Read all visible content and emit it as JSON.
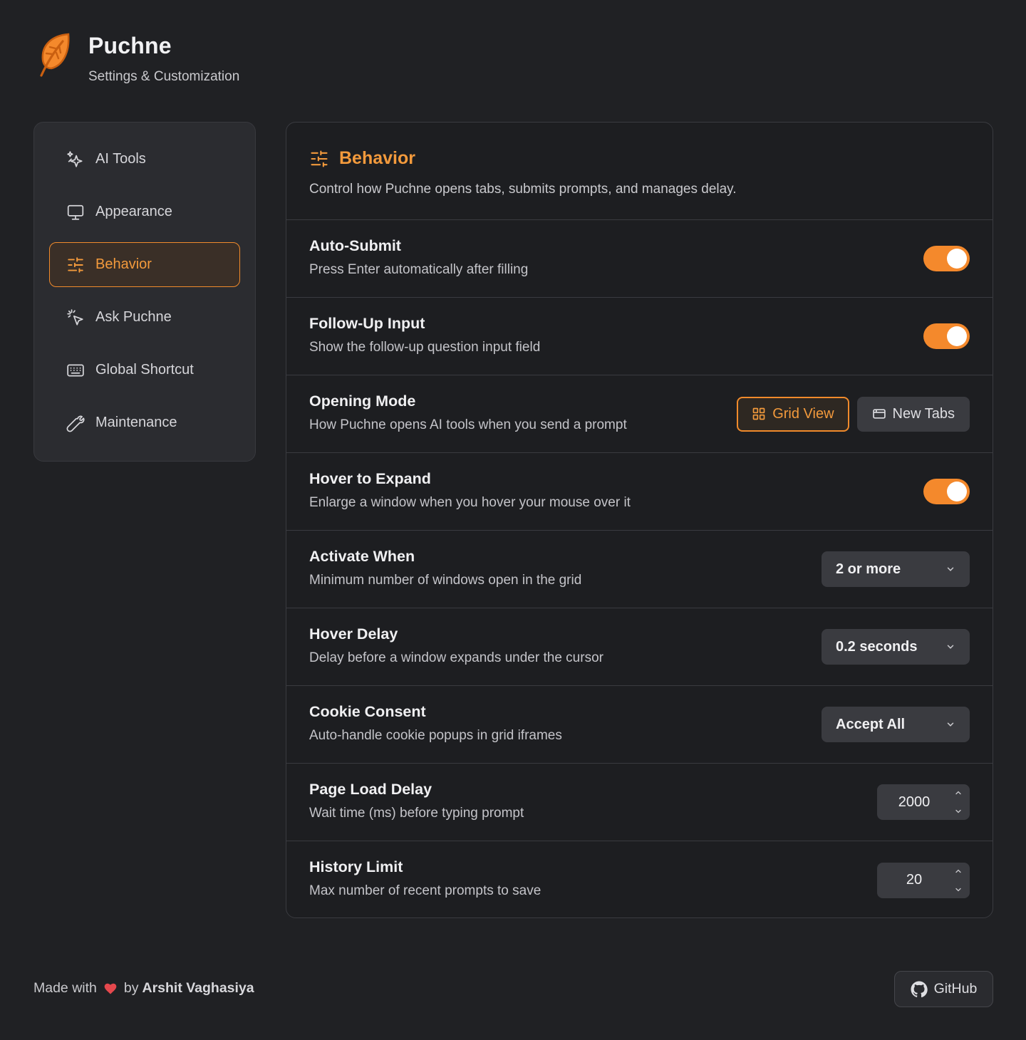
{
  "app": {
    "title": "Puchne",
    "subtitle": "Settings & Customization",
    "logo_icon": "leaf-icon"
  },
  "accent_color": "#f4892c",
  "sidebar": {
    "items": [
      {
        "label": "AI Tools",
        "icon": "sparkles-icon",
        "active": false
      },
      {
        "label": "Appearance",
        "icon": "monitor-icon",
        "active": false
      },
      {
        "label": "Behavior",
        "icon": "sliders-icon",
        "active": true
      },
      {
        "label": "Ask Puchne",
        "icon": "cursor-click-icon",
        "active": false
      },
      {
        "label": "Global Shortcut",
        "icon": "keyboard-icon",
        "active": false
      },
      {
        "label": "Maintenance",
        "icon": "wrench-icon",
        "active": false
      }
    ]
  },
  "panel": {
    "title": "Behavior",
    "description": "Control how Puchne opens tabs, submits prompts, and manages delay.",
    "settings": {
      "auto_submit": {
        "title": "Auto-Submit",
        "desc": "Press Enter automatically after filling",
        "enabled": true
      },
      "follow_up": {
        "title": "Follow-Up Input",
        "desc": "Show the follow-up question input field",
        "enabled": true
      },
      "opening_mode": {
        "title": "Opening Mode",
        "desc": "How Puchne opens AI tools when you send a prompt",
        "options": [
          "Grid View",
          "New Tabs"
        ],
        "selected": "Grid View"
      },
      "hover_expand": {
        "title": "Hover to Expand",
        "desc": "Enlarge a window when you hover your mouse over it",
        "enabled": true
      },
      "activate_when": {
        "title": "Activate When",
        "desc": "Minimum number of windows open in the grid",
        "value": "2 or more"
      },
      "hover_delay": {
        "title": "Hover Delay",
        "desc": "Delay before a window expands under the cursor",
        "value": "0.2 seconds"
      },
      "cookie_consent": {
        "title": "Cookie Consent",
        "desc": "Auto-handle cookie popups in grid iframes",
        "value": "Accept All"
      },
      "page_load_delay": {
        "title": "Page Load Delay",
        "desc": "Wait time (ms) before typing prompt",
        "value": "2000"
      },
      "history_limit": {
        "title": "History Limit",
        "desc": "Max number of recent prompts to save",
        "value": "20"
      }
    }
  },
  "footer": {
    "made_with": "Made with",
    "by": "by",
    "author": "Arshit Vaghasiya",
    "github_label": "GitHub"
  }
}
